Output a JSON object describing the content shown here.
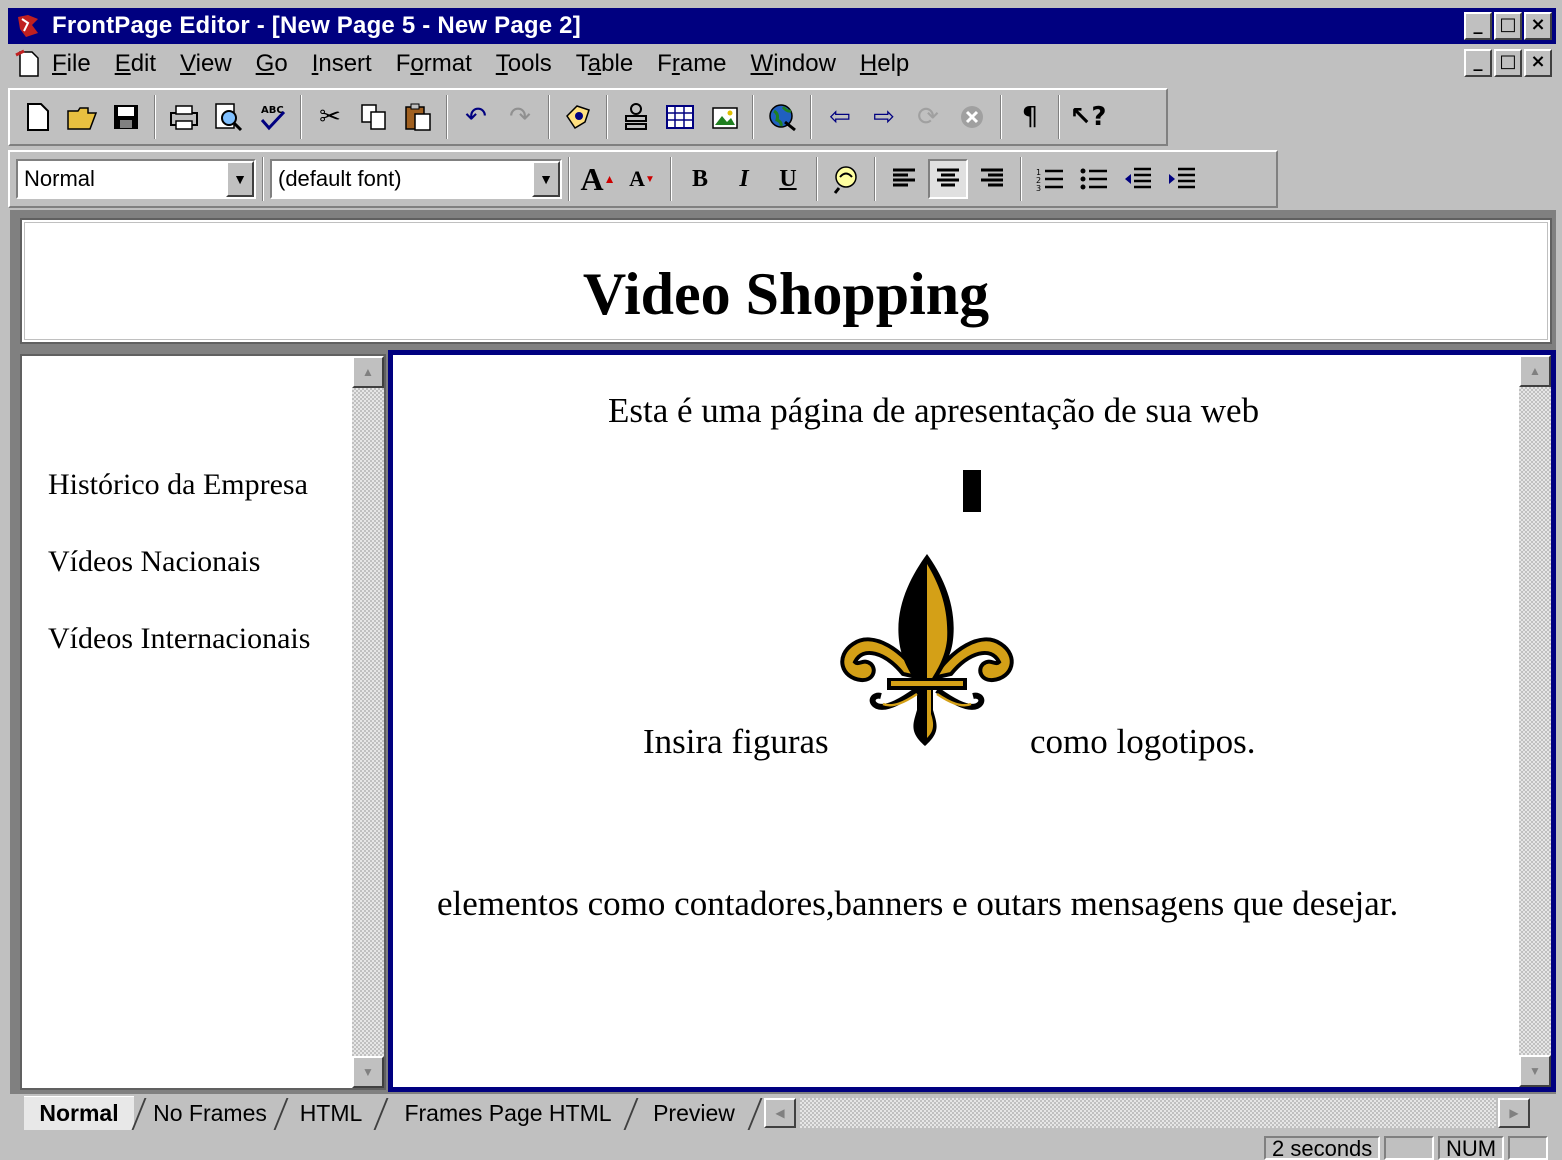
{
  "window": {
    "title": "FrontPage Editor - [New Page 5 - New Page 2]",
    "controls": [
      "_",
      "□",
      "×"
    ],
    "doc_controls": [
      "_",
      "□",
      "×"
    ]
  },
  "menu": {
    "items": [
      {
        "pre": "",
        "u": "F",
        "post": "ile"
      },
      {
        "pre": "",
        "u": "E",
        "post": "dit"
      },
      {
        "pre": "",
        "u": "V",
        "post": "iew"
      },
      {
        "pre": "",
        "u": "G",
        "post": "o"
      },
      {
        "pre": "",
        "u": "I",
        "post": "nsert"
      },
      {
        "pre": "F",
        "u": "o",
        "post": "rmat"
      },
      {
        "pre": "",
        "u": "T",
        "post": "ools"
      },
      {
        "pre": "T",
        "u": "a",
        "post": "ble"
      },
      {
        "pre": "F",
        "u": "r",
        "post": "ame"
      },
      {
        "pre": "",
        "u": "W",
        "post": "indow"
      },
      {
        "pre": "",
        "u": "H",
        "post": "elp"
      }
    ]
  },
  "toolbar2": {
    "style_value": "Normal",
    "font_value": "(default font)",
    "bold": "B",
    "italic": "I",
    "underline": "U"
  },
  "page": {
    "banner_title": "Video Shopping",
    "nav_links": [
      "Histórico da Empresa",
      "Vídeos Nacionais",
      "Vídeos Internacionais"
    ],
    "intro": "Esta é uma página de apresentação de sua web",
    "logo_left": "Insira figuras",
    "logo_right": "como logotipos.",
    "bottom_text": "elementos como contadores,banners e outars mensagens que desejar.",
    "colors": {
      "logo_gold": "#d4a017",
      "frame_border": "#000080"
    }
  },
  "tabs": [
    "Normal",
    "No Frames",
    "HTML",
    "Frames Page HTML",
    "Preview"
  ],
  "status": {
    "time": "2 seconds",
    "num": "NUM"
  }
}
